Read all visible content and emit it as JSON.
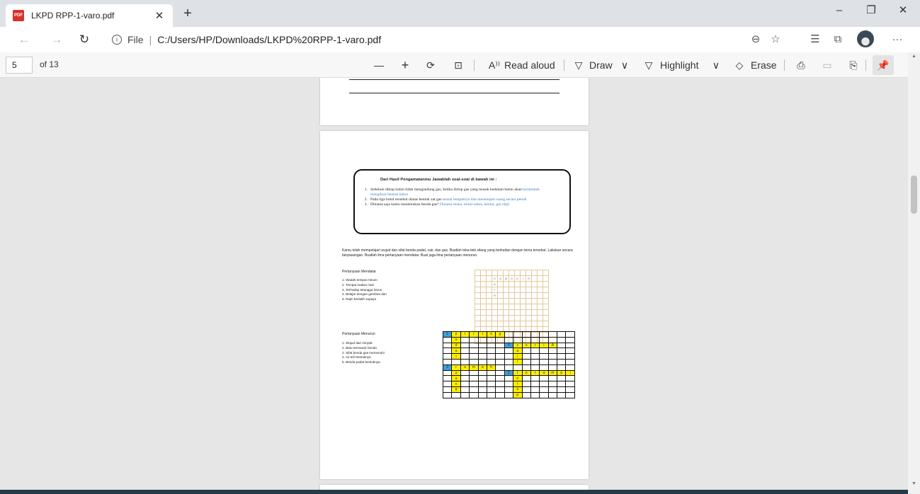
{
  "tab": {
    "title": "LKPD RPP-1-varo.pdf",
    "close": "✕",
    "new_tab": "+"
  },
  "window": {
    "minimize": "–",
    "restore": "❐",
    "close": "✕"
  },
  "nav": {
    "back": "←",
    "forward": "→",
    "refresh": "↻"
  },
  "address": {
    "prefix": "File",
    "separator": "|",
    "url": "C:/Users/HP/Downloads/LKPD%20RPP-1-varo.pdf",
    "info": "i"
  },
  "toolbar_icons": {
    "zoom": "⊖",
    "favorite": "☆",
    "favorites_list": "☰",
    "collections": "⧉",
    "more": "···"
  },
  "pdf_toolbar": {
    "page_number": "5",
    "page_total": "of 13",
    "zoom_out": "—",
    "zoom_in": "+",
    "rotate": "⟳",
    "fit": "⊡",
    "read_aloud_icon": "A⁾⁾",
    "read_aloud": "Read aloud",
    "draw_icon": "▽",
    "draw": "Draw",
    "draw_chevron": "∨",
    "highlight_icon": "▽",
    "highlight": "Highlight",
    "highlight_chevron": "∨",
    "erase_icon": "◇",
    "erase": "Erase",
    "print": "⎙",
    "save": "▭",
    "save_as": "⎘",
    "pin": "📌"
  },
  "scrollbar": {
    "position_fraction": 0.3,
    "up": "▲",
    "down": "▼"
  },
  "doc": {
    "question_box": {
      "title": "Dari Hasil Pengamatanmu Jawablah soal-soal di bawah ini :",
      "items": [
        {
          "n": "1.",
          "q": "Sebelum ditiup balon tidak mengandung gas, ketika ditiup gas yang masuk kedalam balon akan ",
          "a": "bertambah mengikuti bentuk balon"
        },
        {
          "n": "2.",
          "q": "Pada tiga botol tersebut diatas bentuk zat gas ",
          "a": "sesuai tempatnya dan menempati ruang secara penuh"
        },
        {
          "n": "3.",
          "q": "Dimana saja kamu menemukan benda gas? ",
          "a": "Dimana mana, misal udara, kentut, gas elpji"
        }
      ]
    },
    "paragraph": "Kamu telah mempelajari wujud dan sifat benda padat, cair, dan gas. Buatlah teka-teki silang yang berkaitan dengan tema tersebut. Lakukan secara berpasangan. Buatlah lima pertanyaan mendatar. Buat juga lima pertanyaan menurun.",
    "mendatar_label": "Pertanyaan Mendatar",
    "mendatar": [
      "1. Wadah tempat minum",
      "2. Tempat makan nasi",
      "3. Terhadap tetangga harus",
      "4. Belajar dengan gembira dan",
      "5. Rajin berlatih supaya"
    ],
    "menurun_label": "Pertanyaan Menurun",
    "menurun": [
      "1. Wujud dari minyak",
      "2. Batu termasuk benda",
      "3. Sifat benda gas memenuhi",
      "4. Air teh bentuknya",
      "5. Benda padat bentuknya"
    ],
    "example_word": [
      "G",
      "A",
      "M",
      "G",
      "K",
      "I",
      "R"
    ],
    "example_down": [
      "A",
      "I",
      "R"
    ],
    "crossword": [
      [
        "b:1",
        "y:p",
        "y:i",
        "y:r",
        "y:i",
        "y:n",
        "y:g",
        "",
        "",
        "",
        "",
        "",
        ""
      ],
      [
        "",
        "y:a",
        "",
        "",
        "",
        "",
        "",
        "",
        "",
        "",
        "",
        "",
        ""
      ],
      [
        "",
        "y:d",
        "",
        "",
        "",
        "",
        "",
        "b:4",
        "y:c",
        "y:e",
        "y:r",
        "y:i",
        "y:A"
      ],
      [
        "",
        "y:a",
        "",
        "",
        "",
        "",
        "",
        "",
        "y:a",
        "",
        "",
        "",
        ""
      ],
      [
        "",
        "y:t",
        "",
        "",
        "",
        "",
        "",
        "",
        "y:i",
        "",
        "",
        "",
        ""
      ],
      [
        "",
        "",
        "",
        "",
        "",
        "",
        "",
        "",
        "y:r",
        "",
        "",
        "",
        ""
      ],
      [
        "b:3",
        "y:r",
        "y:a",
        "y:m",
        "y:a",
        "y:h",
        "",
        "",
        "",
        "",
        "",
        "",
        ""
      ],
      [
        "",
        "y:u",
        "",
        "",
        "",
        "",
        "",
        "b:5",
        "y:t",
        "y:e",
        "y:r",
        "y:a",
        "y:m",
        "y:p",
        "y:i",
        "y:l"
      ],
      [
        "",
        "y:a",
        "",
        "",
        "",
        "",
        "",
        "",
        "y:e",
        "",
        "",
        "",
        "",
        "",
        "",
        ""
      ],
      [
        "",
        "y:n",
        "",
        "",
        "",
        "",
        "",
        "",
        "y:t",
        "",
        "",
        "",
        "",
        "",
        "",
        ""
      ],
      [
        "",
        "y:g",
        "",
        "",
        "",
        "",
        "",
        "",
        "y:a",
        "",
        "",
        "",
        "",
        "",
        "",
        ""
      ],
      [
        "",
        "",
        "",
        "",
        "",
        "",
        "",
        "",
        "y:p",
        "",
        "",
        "",
        "",
        "",
        "",
        ""
      ]
    ]
  }
}
